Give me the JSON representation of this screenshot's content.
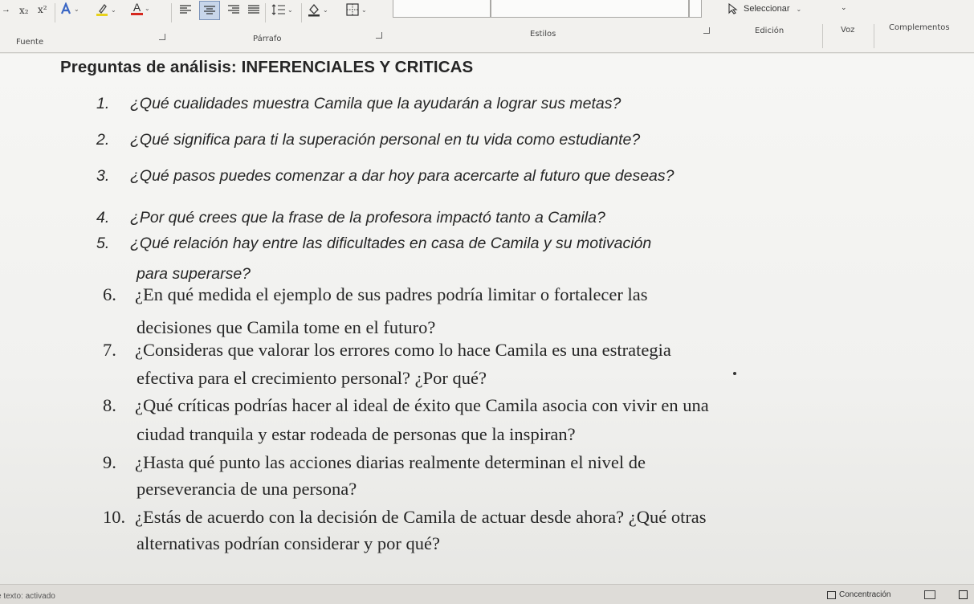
{
  "ribbon": {
    "fuente_label": "Fuente",
    "parrafo_label": "Párrafo",
    "estilos_label": "Estilos",
    "edicion_label": "Edición",
    "voz_label": "Voz",
    "complementos_label": "Complementos",
    "seleccionar_label": "Seleccionar",
    "subscript_label": "x₂",
    "superscript_label": "x²",
    "font_color_label": "A",
    "dropdown_glyph": "⌄"
  },
  "document": {
    "heading": "Preguntas de análisis: INFERENCIALES Y CRITICAS",
    "questions": [
      {
        "num": "1.",
        "lines": [
          "¿Qué cualidades muestra Camila que la ayudarán a lograr sus metas?"
        ]
      },
      {
        "num": "2.",
        "lines": [
          "¿Qué significa para ti la superación personal en tu vida como estudiante?"
        ]
      },
      {
        "num": "3.",
        "lines": [
          "¿Qué pasos puedes comenzar a dar hoy para acercarte al futuro que deseas?"
        ]
      },
      {
        "num": "4.",
        "lines": [
          "¿Por qué crees que la frase de la profesora impactó tanto a Camila?"
        ]
      },
      {
        "num": "5.",
        "lines": [
          "¿Qué relación hay entre las dificultades en casa de Camila y su motivación",
          "para superarse?"
        ]
      },
      {
        "num": "6.",
        "lines": [
          "¿En qué medida el ejemplo de sus padres podría limitar o fortalecer las",
          "decisiones que Camila tome en el futuro?"
        ]
      },
      {
        "num": "7.",
        "lines": [
          "¿Consideras que valorar los errores como lo hace Camila es una estrategia",
          "efectiva para el crecimiento personal? ¿Por qué?"
        ]
      },
      {
        "num": "8.",
        "lines": [
          "¿Qué críticas podrías hacer al ideal de éxito que Camila asocia con vivir en una",
          "ciudad tranquila y estar rodeada de personas que la inspiran?"
        ]
      },
      {
        "num": "9.",
        "lines": [
          "¿Hasta qué punto las acciones diarias realmente determinan el nivel de",
          "perseverancia de una persona?"
        ]
      },
      {
        "num": "10.",
        "lines": [
          "¿Estás de acuerdo con la decisión de Camila de actuar desde ahora? ¿Qué otras",
          "alternativas podrían considerar y por qué?"
        ]
      }
    ]
  },
  "status": {
    "text_predictions": "e texto: activado",
    "focus_label": "Concentración"
  }
}
